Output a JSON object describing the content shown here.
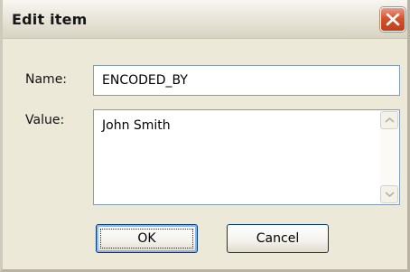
{
  "dialog": {
    "title": "Edit item",
    "close_icon": "close-icon"
  },
  "form": {
    "name_label": "Name:",
    "name_value": "ENCODED_BY",
    "value_label": "Value:",
    "value_text": "John Smith"
  },
  "buttons": {
    "ok_label": "OK",
    "cancel_label": "Cancel"
  },
  "colors": {
    "close_button": "#d4532f",
    "field_border": "#7f9db9",
    "button_border": "#003c74"
  }
}
